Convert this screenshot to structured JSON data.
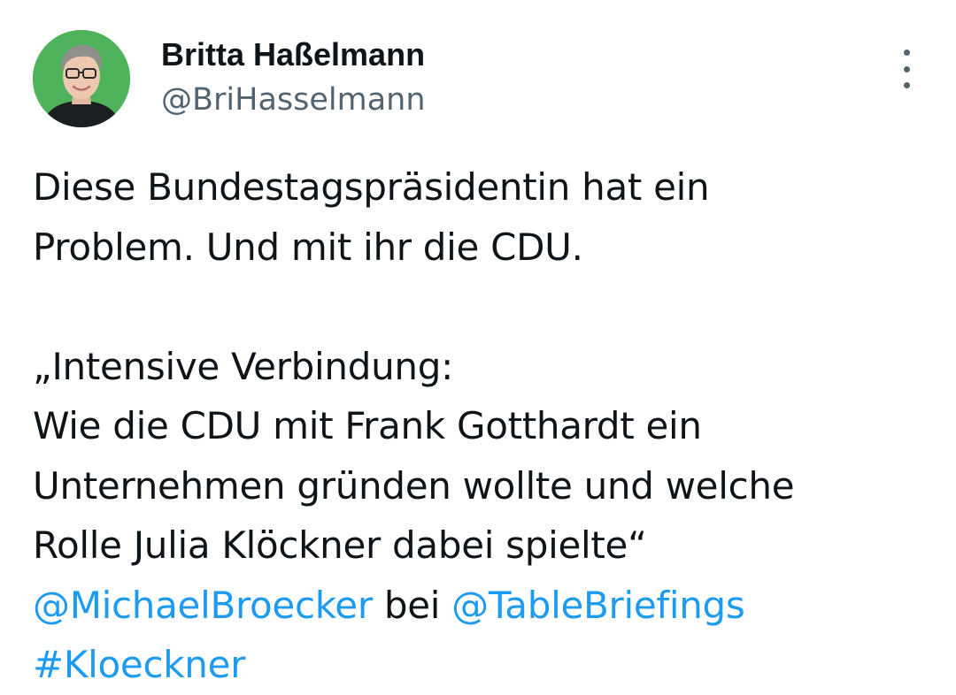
{
  "author": {
    "name": "Britta Haßelmann",
    "handle": "@BriHasselmann"
  },
  "more_menu_icon": "more-vertical-icon",
  "colors": {
    "link": "#1d9bf0",
    "text": "#0f1419",
    "secondary": "#536471",
    "avatar_bg": "#4fb35c"
  },
  "tweet": {
    "line1": "Diese Bundestagspräsidentin hat ein",
    "line2": "Problem. Und mit ihr die CDU.",
    "line3": "„Intensive Verbindung:",
    "line4": "Wie die CDU mit Frank Gotthardt ein",
    "line5": "Unternehmen gründen wollte und welche",
    "line6": "Rolle Julia Klöckner dabei spielte“",
    "mention1": "@MichaelBroecker",
    "mention_connector": " bei ",
    "mention2": "@TableBriefings",
    "hashtag": "#Kloeckner"
  }
}
